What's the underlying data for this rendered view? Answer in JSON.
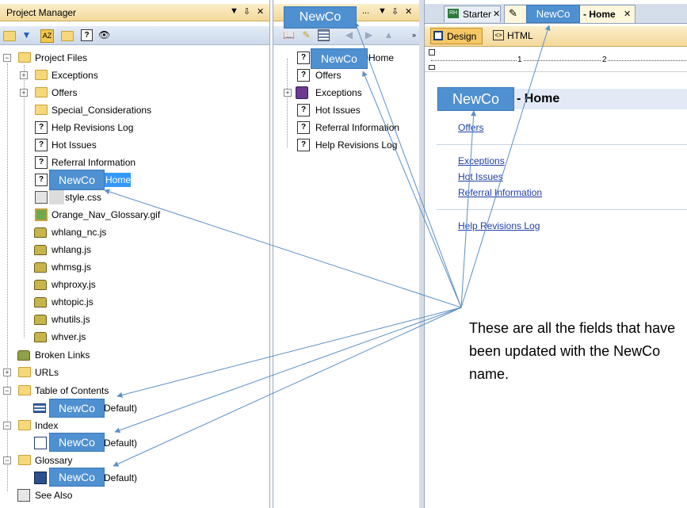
{
  "project_manager": {
    "title": "Project Manager",
    "pin": "⇩",
    "close": "✕",
    "tree": {
      "project_files": "Project Files",
      "exceptions": "Exceptions",
      "offers": "Offers",
      "special": "Special_Considerations",
      "help_rev": "Help Revisions Log",
      "hot": "Hot Issues",
      "referral": "Referral Information",
      "home_suffix": "Home",
      "style": "style.css",
      "gif": "Orange_Nav_Glossary.gif",
      "js": [
        "whlang_nc.js",
        "whlang.js",
        "whmsg.js",
        "whproxy.js",
        "whtopic.js",
        "whutils.js",
        "whver.js"
      ],
      "broken": "Broken Links",
      "urls": "URLs",
      "toc": "Table of Contents",
      "toc_default": "Default)",
      "index": "Index",
      "index_default": "Default)",
      "glossary": "Glossary",
      "glossary_default": "Default)",
      "see_also": "See Also"
    }
  },
  "toc_pane": {
    "title_suffix": "...",
    "items": {
      "home": "Home",
      "offers": "Offers",
      "exceptions": "Exceptions",
      "hot": "Hot Issues",
      "referral": "Referral Information",
      "help_rev": "Help Revisions Log"
    }
  },
  "editor": {
    "tab_starter": "Starter",
    "tab_home_suffix": "- Home",
    "design": "Design",
    "html": "HTML",
    "ruler_1": "1",
    "ruler_2": "2",
    "heading_suffix": "- Home",
    "links": {
      "offers": "Offers",
      "exceptions": "Exceptions",
      "hot": "Hot Issues",
      "referral": "Referral Information",
      "help_rev": "Help Revisions Log"
    }
  },
  "callout": {
    "newco": "NewCo",
    "note": "These are all the fields that have been updated with the NewCo name."
  },
  "colors": {
    "callout_box": "#4f90d0",
    "arrow": "#5b8fc7"
  }
}
